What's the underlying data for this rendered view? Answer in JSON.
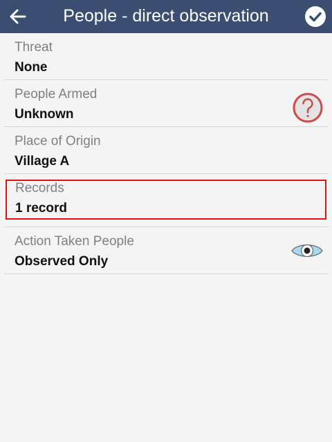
{
  "header": {
    "title": "People - direct observation",
    "back_icon": "arrow-left-icon",
    "confirm_icon": "check-circle-icon"
  },
  "fields": [
    {
      "label": "Threat",
      "value": "None"
    },
    {
      "label": "People Armed",
      "value": "Unknown",
      "icon": "question-icon"
    },
    {
      "label": "Place of Origin",
      "value": "Village A"
    },
    {
      "label": "Records",
      "value": "1 record"
    },
    {
      "label": "Action Taken People",
      "value": "Observed Only",
      "icon": "eye-icon"
    }
  ],
  "colors": {
    "header": "#3b4d70",
    "highlight": "#e31010"
  }
}
